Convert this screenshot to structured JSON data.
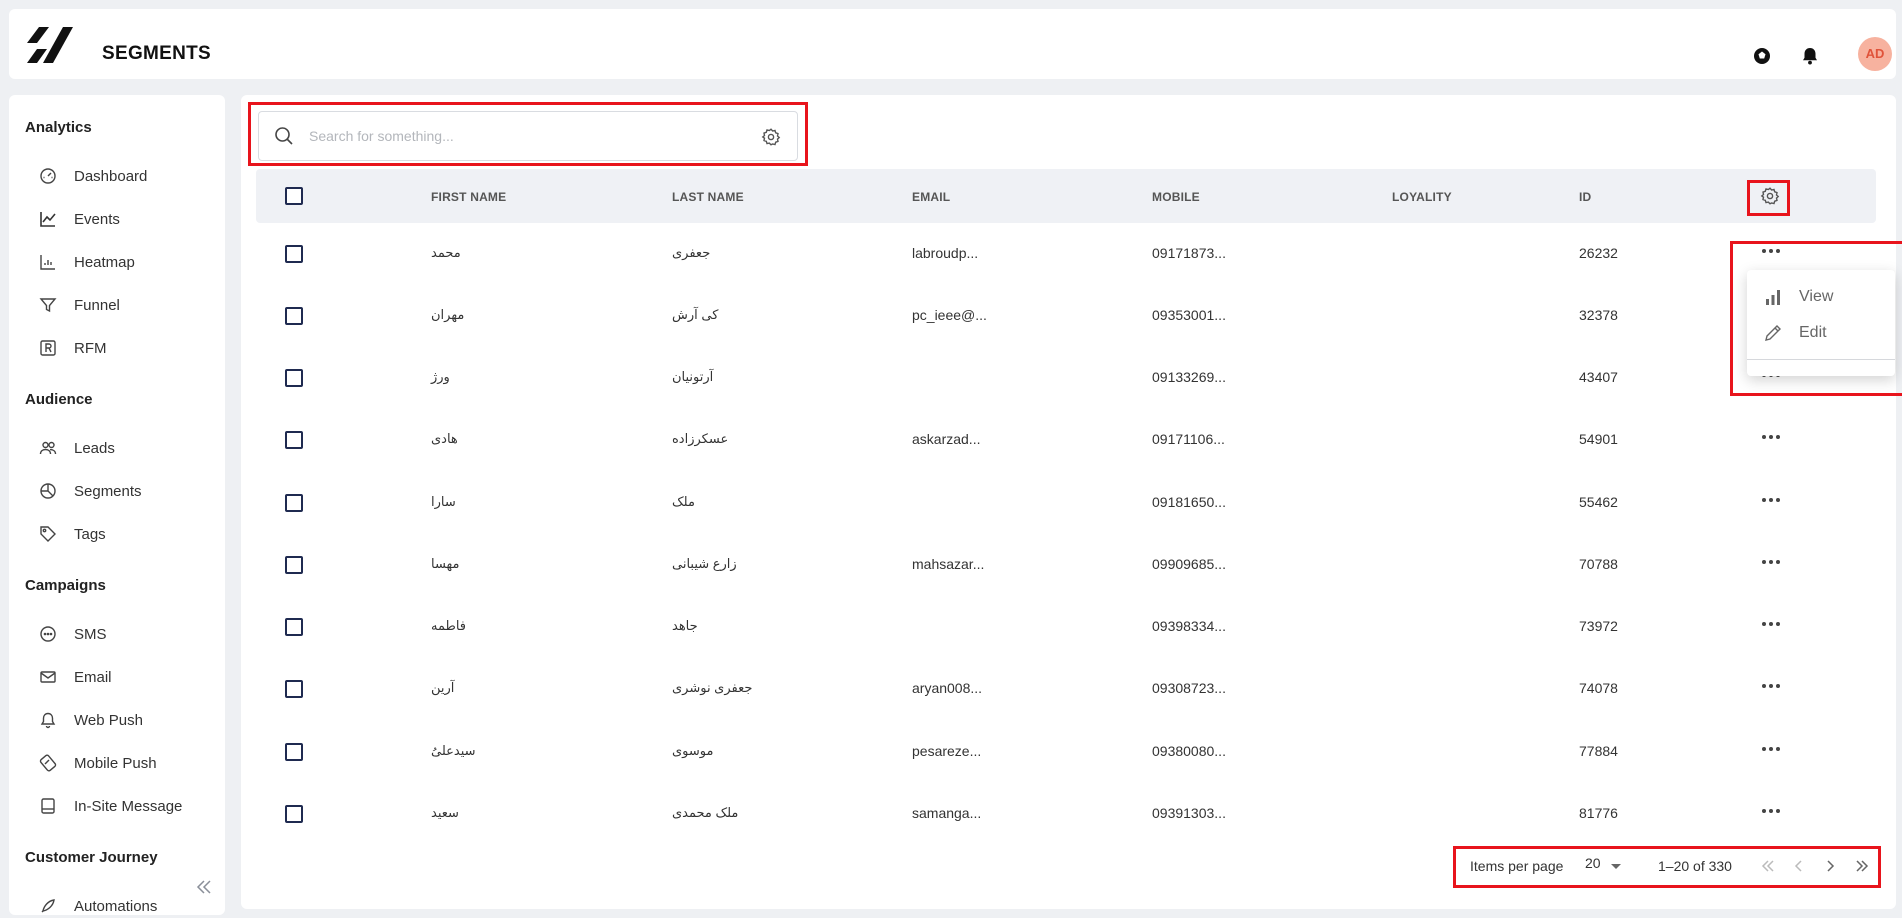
{
  "app": {
    "title": "SEGMENTS",
    "avatar_initials": "AD"
  },
  "colors": {
    "accent": "#e8141c",
    "avatar_bg": "#f7b29f",
    "avatar_fg": "#e0533a",
    "checkbox": "#1f2a50"
  },
  "header_icons": [
    "soccer-ball-icon",
    "bell-icon"
  ],
  "sidebar": {
    "sections": [
      {
        "title": "Analytics",
        "items": [
          {
            "label": "Dashboard",
            "icon": "gauge-icon"
          },
          {
            "label": "Events",
            "icon": "line-chart-icon"
          },
          {
            "label": "Heatmap",
            "icon": "heatmap-icon"
          },
          {
            "label": "Funnel",
            "icon": "funnel-icon"
          },
          {
            "label": "RFM",
            "icon": "rfm-icon"
          }
        ]
      },
      {
        "title": "Audience",
        "items": [
          {
            "label": "Leads",
            "icon": "users-icon"
          },
          {
            "label": "Segments",
            "icon": "pie-chart-icon"
          },
          {
            "label": "Tags",
            "icon": "tag-icon"
          }
        ]
      },
      {
        "title": "Campaigns",
        "items": [
          {
            "label": "SMS",
            "icon": "chat-bubble-icon"
          },
          {
            "label": "Email",
            "icon": "envelope-icon"
          },
          {
            "label": "Web Push",
            "icon": "bell-outline-icon"
          },
          {
            "label": "Mobile Push",
            "icon": "mobile-push-icon"
          },
          {
            "label": "In-Site Message",
            "icon": "message-box-icon"
          }
        ]
      },
      {
        "title": "Customer Journey",
        "items": [
          {
            "label": "Automations",
            "icon": "rocket-icon"
          }
        ]
      }
    ]
  },
  "search": {
    "placeholder": "Search for something..."
  },
  "table": {
    "columns": [
      "FIRST NAME",
      "LAST NAME",
      "EMAIL",
      "MOBILE",
      "LOYALITY",
      "ID"
    ],
    "rows": [
      {
        "first": "محمد",
        "last": "جعفری",
        "email": "labroudp...",
        "mobile": "09171873...",
        "loyalty": "",
        "id": "26232"
      },
      {
        "first": "مهران",
        "last": "کی آرش",
        "email": "pc_ieee@...",
        "mobile": "09353001...",
        "loyalty": "",
        "id": "32378"
      },
      {
        "first": "ورژ",
        "last": "آرتونیان",
        "email": "",
        "mobile": "09133269...",
        "loyalty": "",
        "id": "43407"
      },
      {
        "first": "هادی",
        "last": "عسکرزاده",
        "email": "askarzad...",
        "mobile": "09171106...",
        "loyalty": "",
        "id": "54901"
      },
      {
        "first": "سارا",
        "last": "ملک",
        "email": "",
        "mobile": "09181650...",
        "loyalty": "",
        "id": "55462"
      },
      {
        "first": "مهسا",
        "last": "زارع شیبانی",
        "email": "mahsazar...",
        "mobile": "09909685...",
        "loyalty": "",
        "id": "70788"
      },
      {
        "first": "فاطمه",
        "last": "جاهد",
        "email": "",
        "mobile": "09398334...",
        "loyalty": "",
        "id": "73972"
      },
      {
        "first": "آرین",
        "last": "جعفری نوشری",
        "email": "aryan008...",
        "mobile": "09308723...",
        "loyalty": "",
        "id": "74078"
      },
      {
        "first": "سیدعلیُ",
        "last": "موسوی",
        "email": "pesareze...",
        "mobile": "09380080...",
        "loyalty": "",
        "id": "77884"
      },
      {
        "first": "سعید",
        "last": "ملک محمدی",
        "email": "samanga...",
        "mobile": "09391303...",
        "loyalty": "",
        "id": "81776"
      }
    ]
  },
  "row_menu": {
    "items": [
      {
        "label": "View",
        "icon": "bar-chart-icon"
      },
      {
        "label": "Edit",
        "icon": "pencil-icon"
      }
    ]
  },
  "pagination": {
    "label": "Items per page",
    "per_page": "20",
    "range": "1–20 of 330"
  }
}
